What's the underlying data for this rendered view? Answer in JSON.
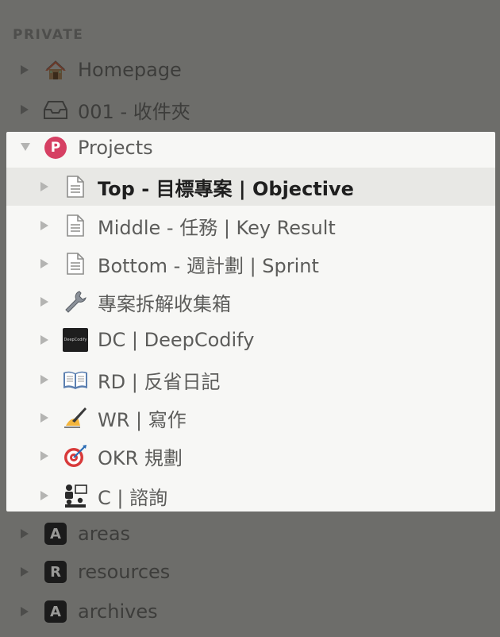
{
  "sidebar": {
    "section_label": "PRIVATE",
    "top_items": [
      {
        "label": "Homepage",
        "icon": "house-icon"
      },
      {
        "label": "001 - 收件夾",
        "icon": "inbox-tray-icon"
      }
    ],
    "projects": {
      "label": "Projects",
      "icon_letter": "P",
      "children": [
        {
          "label": "Top - 目標專案 | Objective",
          "icon": "document-icon",
          "selected": true
        },
        {
          "label": "Middle - 任務 | Key Result",
          "icon": "document-icon"
        },
        {
          "label": "Bottom - 週計劃 | Sprint",
          "icon": "document-icon"
        },
        {
          "label": "專案拆解收集箱",
          "icon": "wrench-icon"
        },
        {
          "label": "DC | DeepCodify",
          "icon": "deepcodify-logo-icon",
          "logo_text": "DeepCodify"
        },
        {
          "label": "RD | 反省日記",
          "icon": "open-book-icon"
        },
        {
          "label": "WR | 寫作",
          "icon": "writing-hand-icon"
        },
        {
          "label": "OKR 規劃",
          "icon": "target-dart-icon"
        },
        {
          "label": "C | 諮詢",
          "icon": "people-consulting-icon"
        }
      ]
    },
    "bottom_items": [
      {
        "label": "areas",
        "badge": "A"
      },
      {
        "label": "resources",
        "badge": "R"
      },
      {
        "label": "archives",
        "badge": "A"
      }
    ]
  },
  "colors": {
    "overlay": "#6d6d6a",
    "panel": "#f7f7f5",
    "selected_row": "#e8e8e5",
    "projects_badge": "#d64063"
  }
}
